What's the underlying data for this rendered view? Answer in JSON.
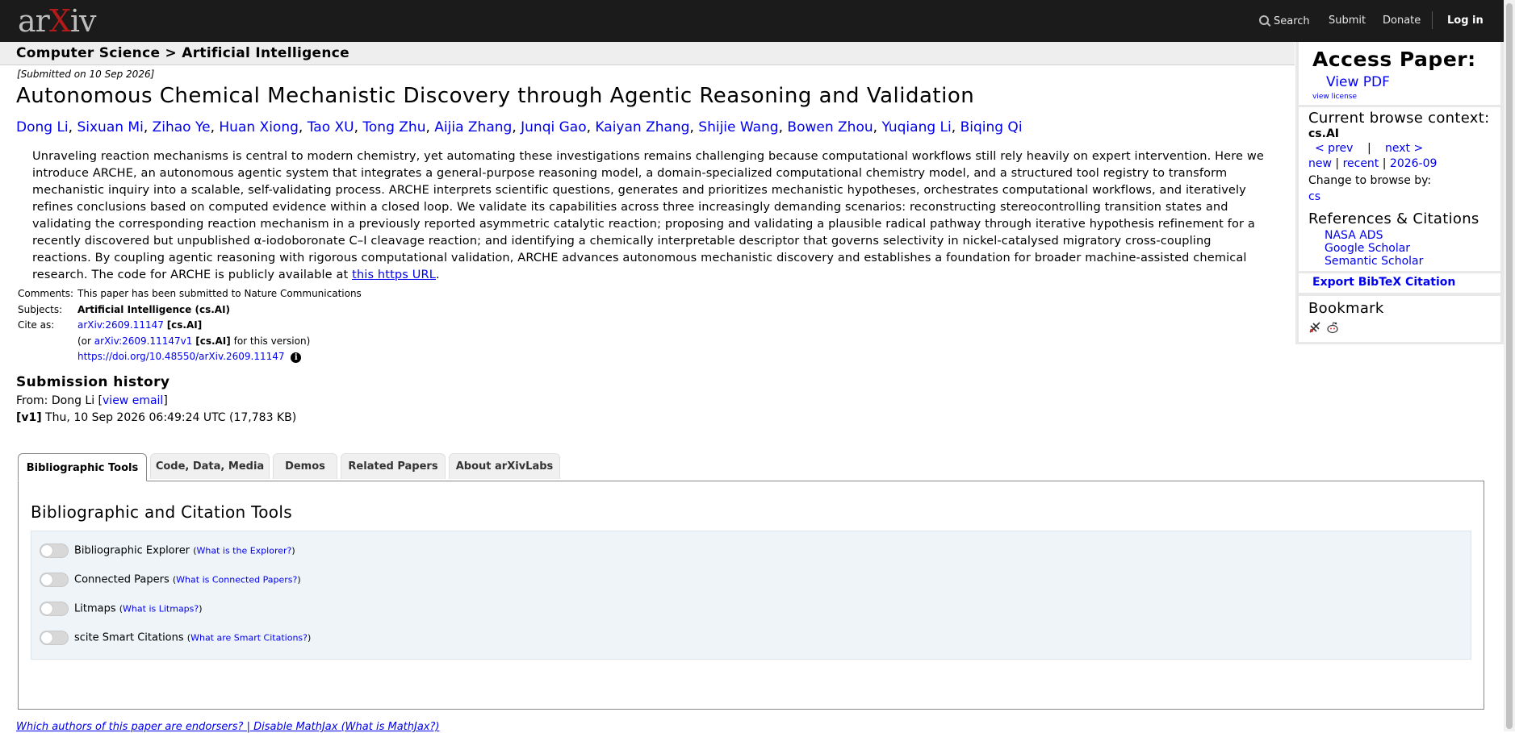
{
  "nav": {
    "logo_pre": "ar",
    "logo_x": "X",
    "logo_post": "iv",
    "search_label": "Search",
    "submit_label": "Submit",
    "donate_label": "Donate",
    "login_label": "Log in"
  },
  "breadcrumb": "Computer Science > Artificial Intelligence",
  "paper": {
    "submitted": "[Submitted on 10 Sep 2026]",
    "title": "Autonomous Chemical Mechanistic Discovery through Agentic Reasoning and Validation",
    "authors": [
      "Dong Li",
      "Sixuan Mi",
      "Zihao Ye",
      "Huan Xiong",
      "Tao XU",
      "Tong Zhu",
      "Aijia Zhang",
      "Junqi Gao",
      "Kaiyan Zhang",
      "Shijie Wang",
      "Bowen Zhou",
      "Yuqiang Li",
      "Biqing Qi"
    ],
    "abstract": "Unraveling reaction mechanisms is central to modern chemistry, yet automating these investigations remains challenging because computational workflows still rely heavily on expert intervention. Here we introduce ARCHE, an autonomous agentic system that integrates a general-purpose reasoning model, a domain-specialized computational chemistry model, and a structured tool registry to transform mechanistic inquiry into a scalable, self-validating process. ARCHE interprets scientific questions, generates and prioritizes mechanistic hypotheses, orchestrates computational workflows, and iteratively refines conclusions based on computed evidence within a closed loop. We validate its capabilities across three increasingly demanding scenarios: reconstructing stereocontrolling transition states and validating the corresponding reaction mechanism in a previously reported asymmetric catalytic reaction; proposing and validating a plausible radical pathway through iterative hypothesis refinement for a recently discovered but unpublished α-iodoboronate C–I cleavage reaction; and identifying a chemically interpretable descriptor that governs selectivity in nickel-catalysed migratory cross-coupling reactions. By coupling agentic reasoning with rigorous computational validation, ARCHE advances autonomous mechanistic discovery and establishes a foundation for broader machine-assisted chemical research. The code for ARCHE is publicly available at",
    "abstract_link": "this https URL",
    "abstract_end": "."
  },
  "meta": {
    "comments_label": "Comments:",
    "comments": "This paper has been submitted to Nature Communications",
    "subjects_label": "Subjects:",
    "subjects": "Artificial Intelligence (cs.AI)",
    "cite_label": "Cite as:",
    "cite_id": "arXiv:2609.11147",
    "cite_cat": "[cs.AI]",
    "cite_or": "(or",
    "cite_version_id": "arXiv:2609.11147v1",
    "cite_version_cat": "[cs.AI]",
    "cite_version_suffix": "for this version)",
    "doi": "https://doi.org/10.48550/arXiv.2609.11147",
    "info_icon": "i"
  },
  "history": {
    "title": "Submission history",
    "from_prefix": "From: Dong Li [",
    "from_link": "view email",
    "from_suffix": "]",
    "v1_label": "[v1]",
    "v1_text": " Thu, 10 Sep 2026 06:49:24 UTC (17,783 KB)"
  },
  "tabs": [
    {
      "label": "Bibliographic Tools"
    },
    {
      "label": "Code, Data, Media"
    },
    {
      "label": "Demos"
    },
    {
      "label": "Related Papers"
    },
    {
      "label": "About arXivLabs"
    }
  ],
  "panel": {
    "title": "Bibliographic and Citation Tools",
    "tools": [
      {
        "label": "Bibliographic Explorer",
        "help": "What is the Explorer?"
      },
      {
        "label": "Connected Papers",
        "help": "What is Connected Papers?"
      },
      {
        "label": "Litmaps",
        "help": "What is Litmaps?"
      },
      {
        "label": "scite Smart Citations",
        "help": "What are Smart Citations?"
      }
    ]
  },
  "footer": "Which authors of this paper are endorsers? | Disable MathJax (What is MathJax?)",
  "sidebar": {
    "access_title": "Access Paper:",
    "view_pdf": "View PDF",
    "view_license": "view license",
    "context_title": "Current browse context:",
    "context_value": "cs.AI",
    "prev": "< prev",
    "pipe": "|",
    "next": "next >",
    "new": "new",
    "recent": "recent",
    "month": "2026-09",
    "change_label": "Change to browse by:",
    "change_cs": "cs",
    "refs_title": "References & Citations",
    "refs": [
      "NASA ADS",
      "Google Scholar",
      "Semantic Scholar"
    ],
    "export": "Export BibTeX Citation",
    "bookmark_title": "Bookmark"
  }
}
